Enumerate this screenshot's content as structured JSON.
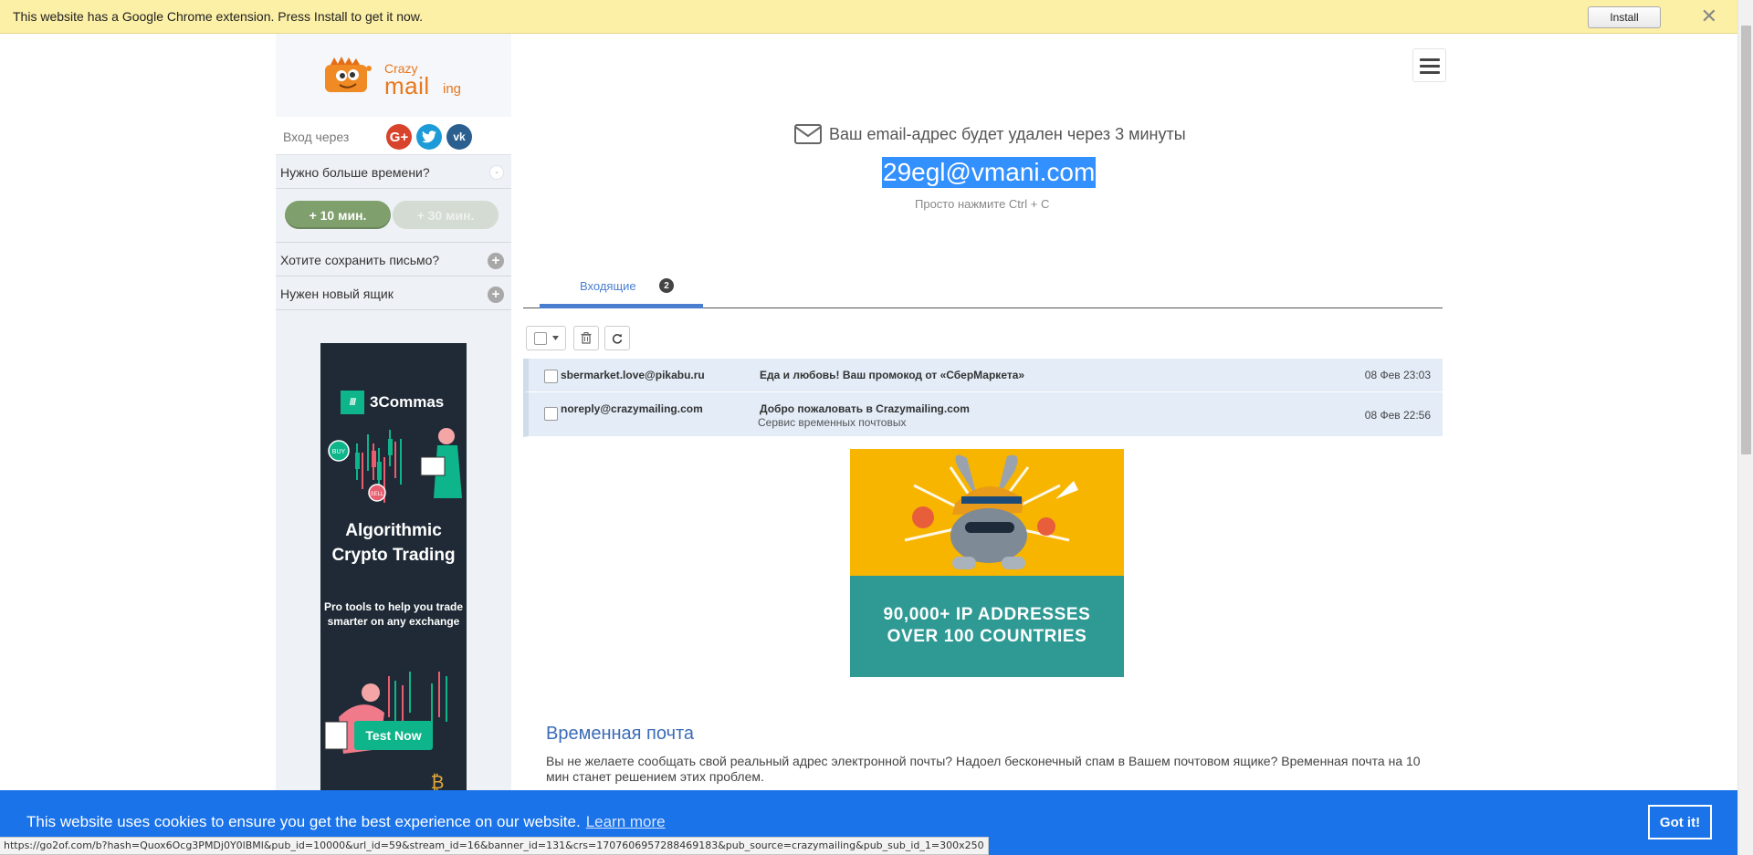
{
  "extension_bar": {
    "message": "This website has a Google Chrome extension. Press Install to get it now.",
    "install_label": "Install",
    "close_symbol": "✕"
  },
  "logo": {
    "word1": "Crazy",
    "word2": "mail",
    "word3": "ing"
  },
  "sidebar": {
    "login_label": "Вход через",
    "social": {
      "google": "G+",
      "twitter": "t",
      "vk": "vk"
    },
    "more_time_label": "Нужно больше времени?",
    "collapse_symbol": "-",
    "btn_10": "+ 10 мин.",
    "btn_30": "+ 30 мин.",
    "save_letter_label": "Хотите сохранить письмо?",
    "new_box_label": "Нужен новый ящик",
    "plus_symbol": "+"
  },
  "side_ad": {
    "brand": "3Commas",
    "brand_mark": "///",
    "title": "Algorithmic Crypto Trading",
    "subtitle": "Pro tools to help you trade smarter on any exchange",
    "cta": "Test Now",
    "badge_buy": "BUY",
    "badge_sell": "SELL"
  },
  "main": {
    "lifetime_text": "Ваш email-адрес будет удален через 3 минуты",
    "email_address": "29egl@vmani.com",
    "copy_hint": "Просто нажмите Ctrl + C"
  },
  "tabs": {
    "inbox_label": "Входящие",
    "inbox_count": "2"
  },
  "messages": [
    {
      "from": "sbermarket.love@pikabu.ru",
      "subject": "Еда и любовь! Ваш промокод от «СберМаркета»",
      "preview": "",
      "date": "08 Фев 23:03"
    },
    {
      "from": "noreply@crazymailing.com",
      "subject": "Добро пожаловать в Crazymailing.com",
      "preview": "Сервис временных почтовых",
      "date": "08 Фев 22:56"
    }
  ],
  "center_ad": {
    "line1": "90,000+ IP ADDRESSES",
    "line2": "OVER 100 COUNTRIES"
  },
  "about": {
    "title": "Временная почта",
    "text": "Вы не желаете сообщать свой реальный адрес электронной почты? Надоел бесконечный спам в Вашем почтовом ящике? Временная почта на 10 мин станет решением этих проблем."
  },
  "cookie": {
    "text": "This website uses cookies to ensure you get the best experience on our website.",
    "learn_more": "Learn more",
    "accept": "Got it!"
  },
  "status_url": "https://go2of.com/b?hash=Quox6Ocg3PMDj0Y0lBMl&pub_id=10000&url_id=59&stream_id=16&banner_id=131&crs=1707606957288469183&pub_source=crazymailing&pub_sub_id_1=300x250",
  "colors": {
    "accent_blue": "#4a7fd0",
    "selection_blue": "#3390ff",
    "cookie_blue": "#1a73e8",
    "logo_orange": "#e8771b",
    "ext_bar_yellow": "#fcefa6"
  }
}
